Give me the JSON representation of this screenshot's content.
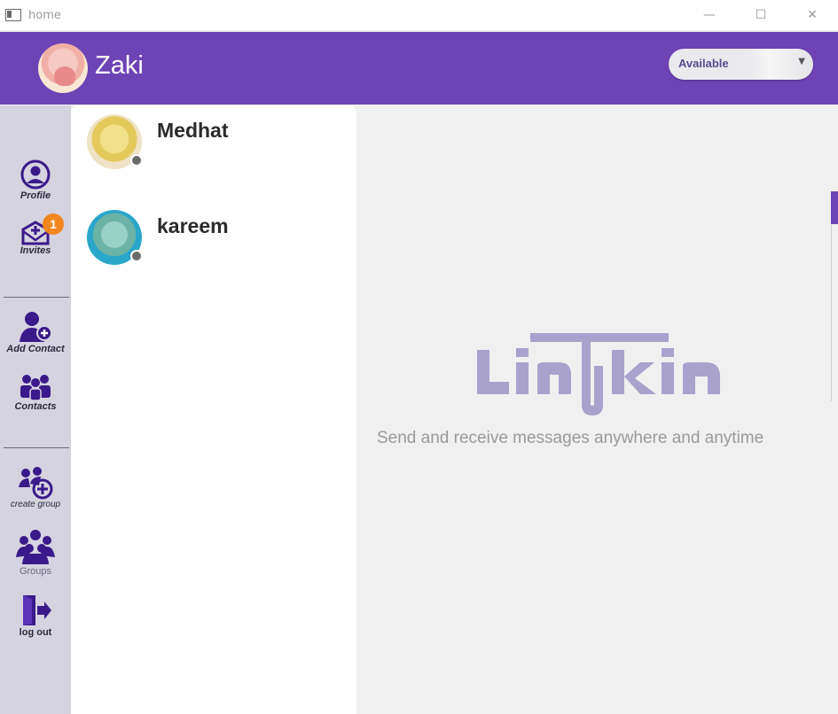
{
  "window": {
    "title": "home",
    "minimize_icon": "—",
    "maximize_icon": "☐",
    "close_icon": "✕"
  },
  "header": {
    "user_name": "Zaki",
    "status": {
      "selected": "Available",
      "options": [
        "Available"
      ]
    },
    "accent_color": "#6e43b6"
  },
  "sidebar": {
    "items": [
      {
        "label": "Profile",
        "icon": "user-circle-icon"
      },
      {
        "label": "Invites",
        "icon": "mail-plus-icon",
        "badge": "1"
      },
      {
        "label": "Add Contact",
        "icon": "add-user-icon"
      },
      {
        "label": "Contacts",
        "icon": "contacts-icon"
      },
      {
        "label": "create group",
        "icon": "create-group-icon"
      },
      {
        "label": "Groups",
        "icon": "groups-icon"
      },
      {
        "label": "log out",
        "icon": "logout-icon"
      }
    ]
  },
  "contacts": [
    {
      "name": "Medhat",
      "status": "offline",
      "avatar": "spongebob-avatar"
    },
    {
      "name": "kareem",
      "status": "offline",
      "avatar": "squidward-avatar"
    }
  ],
  "main": {
    "logo_text": "Linkin",
    "tagline": "Send and receive messages anywhere and anytime"
  }
}
